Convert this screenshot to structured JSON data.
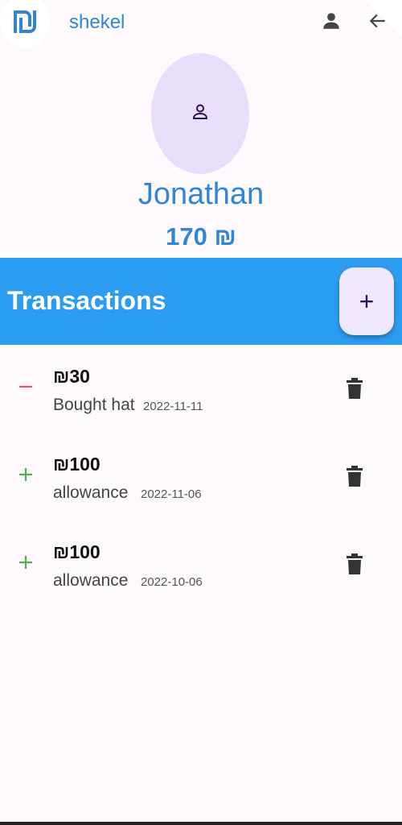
{
  "app": {
    "title": "shekel",
    "logo_icon": "shekel-logo-icon",
    "brand_color": "#2f86d8"
  },
  "header": {
    "profile_icon": "person-icon",
    "back_icon": "arrow-back-icon"
  },
  "profile": {
    "avatar_icon": "person-outline-icon",
    "name": "Jonathan",
    "balance": "170 ₪"
  },
  "transactions": {
    "title": "Transactions",
    "add_label": "+",
    "header_color": "#2c9cf0",
    "items": [
      {
        "type": "expense",
        "sign_icon": "minus-icon",
        "amount": "₪30",
        "description": "Bought hat",
        "date": "2022-11-11",
        "delete_icon": "trash-icon"
      },
      {
        "type": "income",
        "sign_icon": "plus-icon",
        "amount": "₪100",
        "description": "allowance",
        "date": "2022-11-06",
        "delete_icon": "trash-icon"
      },
      {
        "type": "income",
        "sign_icon": "plus-icon",
        "amount": "₪100",
        "description": "allowance",
        "date": "2022-10-06",
        "delete_icon": "trash-icon"
      }
    ]
  },
  "colors": {
    "expense": "#ef5350",
    "income": "#4caf50",
    "avatar_bg": "#e8defc"
  }
}
